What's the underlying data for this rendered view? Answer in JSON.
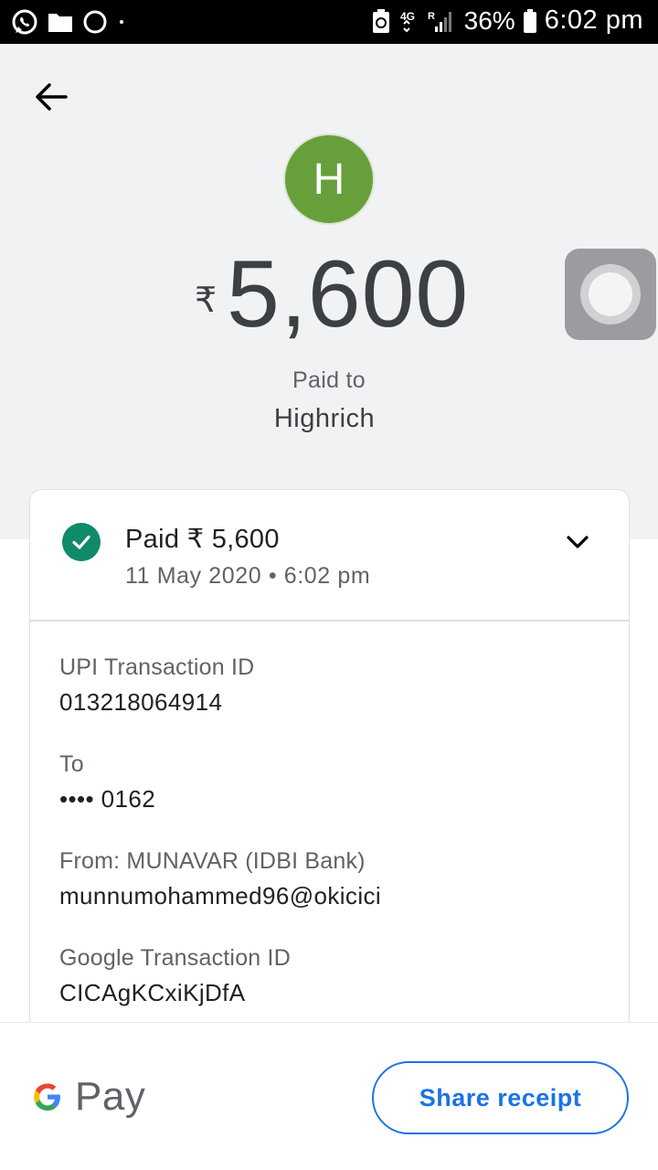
{
  "status_bar": {
    "network": "4G",
    "roaming": "R",
    "battery_percent": "36%",
    "time": "6:02 pm"
  },
  "header": {
    "avatar_letter": "H",
    "currency_symbol": "₹",
    "amount": "5,600",
    "paid_to_label": "Paid to",
    "payee_name": "Highrich"
  },
  "status_card": {
    "status_text": "Paid ₹ 5,600",
    "date_time": "11 May 2020 • 6:02 pm"
  },
  "details": [
    {
      "label": "UPI Transaction ID",
      "value": "013218064914"
    },
    {
      "label": "To",
      "value": "•••• 0162"
    },
    {
      "label": "From: MUNAVAR (IDBI Bank)",
      "value": "munnumohammed96@okicici"
    },
    {
      "label": "Google Transaction ID",
      "value": "CICAgKCxiKjDfA"
    }
  ],
  "footer": {
    "brand_text": "Pay",
    "share_label": "Share receipt"
  },
  "colors": {
    "avatar": "#67a03a",
    "success": "#0f8a6a",
    "accent": "#1a73e8",
    "header_bg": "#f1f2f4"
  }
}
